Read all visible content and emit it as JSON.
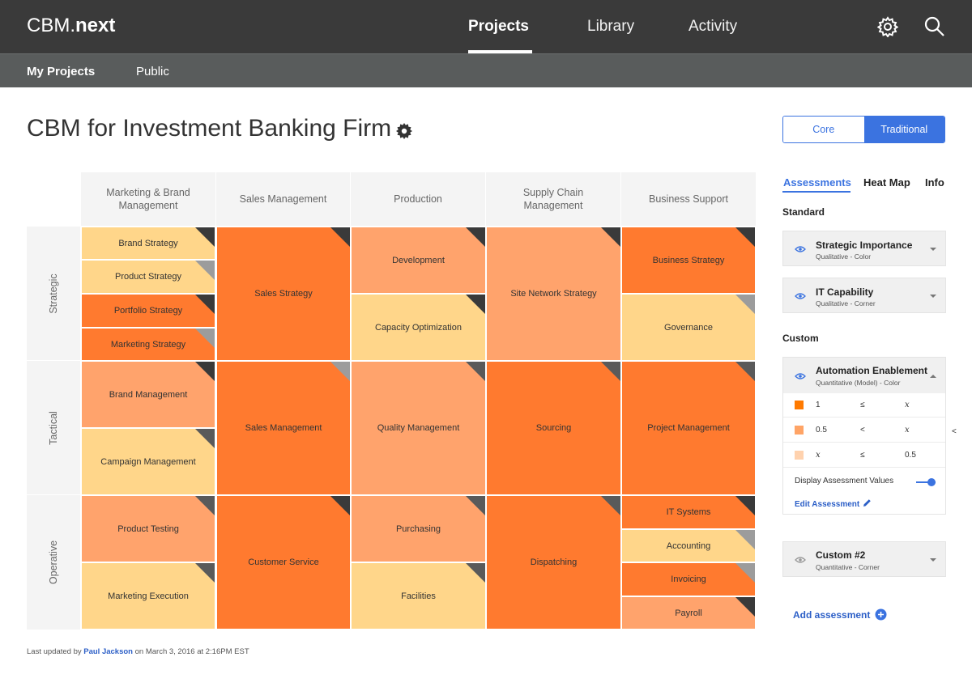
{
  "app": {
    "brand_light": "CBM.",
    "brand_bold": "next"
  },
  "nav": {
    "items": [
      "Projects",
      "Library",
      "Activity"
    ],
    "active": "Projects"
  },
  "subnav": {
    "items": [
      "My Projects",
      "Public"
    ],
    "active": "My Projects"
  },
  "page": {
    "title": "CBM for Investment Banking Firm"
  },
  "view_toggle": {
    "options": [
      "Core",
      "Traditional"
    ],
    "selected": "Traditional"
  },
  "map": {
    "columns": [
      "Marketing & Brand Management",
      "Sales Management",
      "Production",
      "Supply Chain Management",
      "Business Support"
    ],
    "rows": [
      "Strategic",
      "Tactical",
      "Operative"
    ],
    "legend_colors": {
      "high": "#ff7a2f",
      "medium": "#ffa36c",
      "low": "#ffd68a"
    },
    "cells": [
      {
        "label": "Brand Strategy",
        "color": "low",
        "corner": "black"
      },
      {
        "label": "Product Strategy",
        "color": "low",
        "corner": "gray"
      },
      {
        "label": "Portfolio Strategy",
        "color": "high",
        "corner": "black"
      },
      {
        "label": "Marketing Strategy",
        "color": "high",
        "corner": "gray"
      },
      {
        "label": "Sales Strategy",
        "color": "high",
        "corner": "black"
      },
      {
        "label": "Development",
        "color": "medium",
        "corner": "black"
      },
      {
        "label": "Capacity Optimization",
        "color": "low",
        "corner": "black"
      },
      {
        "label": "Site Network Strategy",
        "color": "medium",
        "corner": "black"
      },
      {
        "label": "Business Strategy",
        "color": "high",
        "corner": "black"
      },
      {
        "label": "Governance",
        "color": "low",
        "corner": "gray"
      },
      {
        "label": "Brand Management",
        "color": "medium",
        "corner": "black"
      },
      {
        "label": "Campaign Management",
        "color": "low",
        "corner": "dark-gray"
      },
      {
        "label": "Sales Management",
        "color": "high",
        "corner": "gray"
      },
      {
        "label": "Quality Management",
        "color": "medium",
        "corner": "dark-gray"
      },
      {
        "label": "Sourcing",
        "color": "high",
        "corner": "dark-gray"
      },
      {
        "label": "Project Management",
        "color": "high",
        "corner": "dark-gray"
      },
      {
        "label": "Product Testing",
        "color": "medium",
        "corner": "dark-gray"
      },
      {
        "label": "Marketing Execution",
        "color": "low",
        "corner": "dark-gray"
      },
      {
        "label": "Customer Service",
        "color": "high",
        "corner": "black"
      },
      {
        "label": "Purchasing",
        "color": "medium",
        "corner": "dark-gray"
      },
      {
        "label": "Facilities",
        "color": "low",
        "corner": "dark-gray"
      },
      {
        "label": "Dispatching",
        "color": "high",
        "corner": "dark-gray"
      },
      {
        "label": "IT Systems",
        "color": "high",
        "corner": "black"
      },
      {
        "label": "Accounting",
        "color": "low",
        "corner": "gray"
      },
      {
        "label": "Invoicing",
        "color": "high",
        "corner": "gray"
      },
      {
        "label": "Payroll",
        "color": "medium",
        "corner": "black"
      }
    ]
  },
  "footer": {
    "prefix": "Last updated by",
    "author": "Paul Jackson",
    "suffix": "on March 3, 2016 at 2:16PM EST"
  },
  "panel": {
    "tabs": [
      "Assessments",
      "Heat Map",
      "Info"
    ],
    "active_tab": "Assessments",
    "standard_label": "Standard",
    "custom_label": "Custom",
    "standard": [
      {
        "name": "Strategic Importance",
        "type": "Qualitative - Color"
      },
      {
        "name": "IT Capability",
        "type": "Qualitative - Corner"
      }
    ],
    "custom": [
      {
        "name": "Automation Enablement",
        "type": "Quantitative (Model) - Color",
        "expanded": true
      },
      {
        "name": "Custom #2",
        "type": "Quantitative - Corner",
        "expanded": false
      }
    ],
    "legend": [
      {
        "color": "#ff7a00",
        "left": "1",
        "op": "≤",
        "right": "x"
      },
      {
        "color": "#ffa466",
        "left": "0.5",
        "op": "<",
        "right": "x"
      },
      {
        "color": "#ffd2ae",
        "left": "x",
        "op": "≤",
        "right": "0.5"
      }
    ],
    "side_arrow": "<",
    "display_values_label": "Display Assessment Values",
    "display_values_on": true,
    "edit_label": "Edit Assessment",
    "add_label": "Add assessment"
  }
}
